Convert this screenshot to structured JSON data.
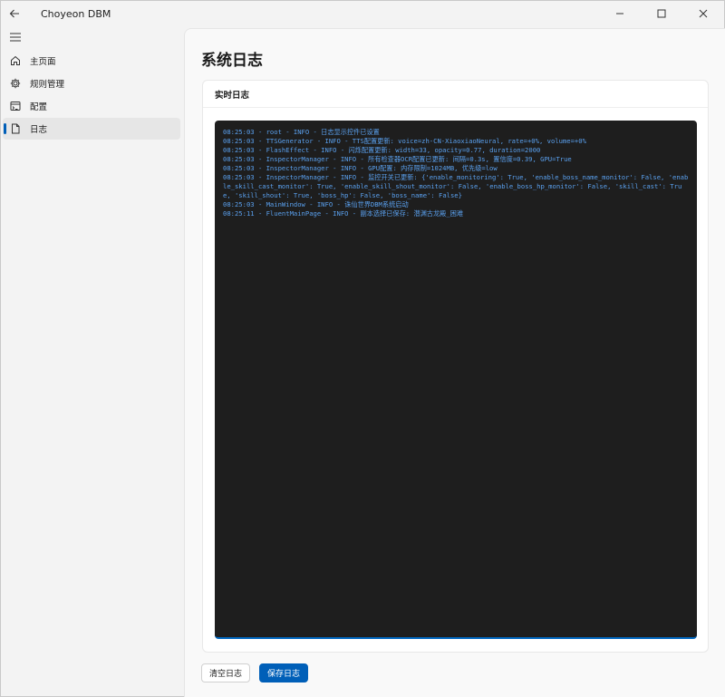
{
  "app": {
    "title": "Choyeon DBM"
  },
  "titlebar": {
    "back_icon": "arrow-left-icon",
    "minimize_icon": "minimize-icon",
    "maximize_icon": "maximize-icon",
    "close_icon": "close-icon"
  },
  "sidebar": {
    "menu_icon": "hamburger-menu-icon",
    "items": [
      {
        "label": "主页面",
        "icon": "home-icon",
        "active": false
      },
      {
        "label": "规则管理",
        "icon": "gear-icon",
        "active": false
      },
      {
        "label": "配置",
        "icon": "config-icon",
        "active": false
      },
      {
        "label": "日志",
        "icon": "document-icon",
        "active": true
      }
    ]
  },
  "main": {
    "page_title": "系统日志",
    "card_title": "实时日志",
    "log_lines": [
      "08:25:03 - root - INFO - 日志显示控件已设置",
      "08:25:03 - TTSGenerator - INFO - TTS配置更新: voice=zh-CN-XiaoxiaoNeural, rate=+0%, volume=+0%",
      "08:25:03 - FlashEffect - INFO - 闪烁配置更新: width=33, opacity=0.77, duration=2000",
      "08:25:03 - InspectorManager - INFO - 所有检查器OCR配置已更新: 间隔=0.3s, 置信度=0.39, GPU=True",
      "08:25:03 - InspectorManager - INFO - GPU配置: 内存限制=1024MB, 优先级=low",
      "08:25:03 - InspectorManager - INFO - 监控开关已更新: {'enable_monitoring': True, 'enable_boss_name_monitor': False, 'enable_skill_cast_monitor': True, 'enable_skill_shout_monitor': False, 'enable_boss_hp_monitor': False, 'skill_cast': True, 'skill_shout': True, 'boss_hp': False, 'boss_name': False}",
      "08:25:03 - MainWindow - INFO - 诛仙世界DBM系统启动",
      "08:25:11 - FluentMainPage - INFO - 副本选择已保存: 潜渊古龙殿_困难"
    ],
    "buttons": {
      "clear_label": "清空日志",
      "save_label": "保存日志"
    }
  },
  "colors": {
    "accent": "#005fb8",
    "log_bg": "#1e1e1e",
    "log_text": "#5aa0ee"
  }
}
